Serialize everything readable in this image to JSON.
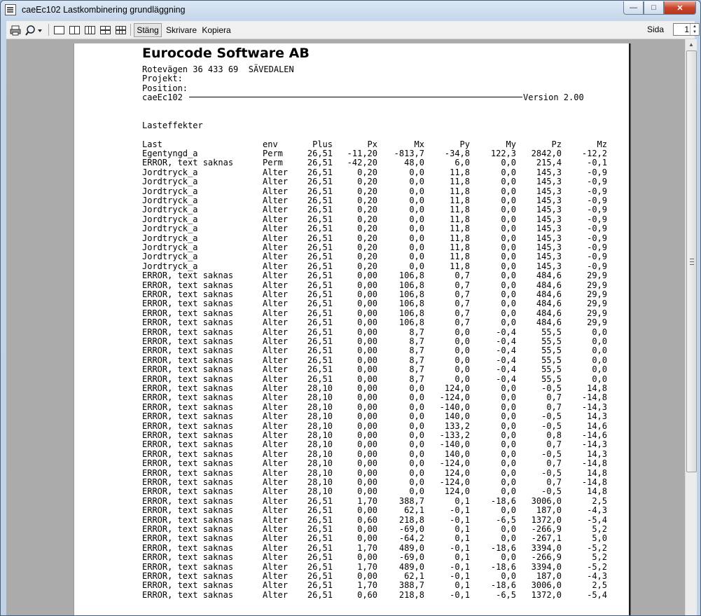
{
  "window": {
    "title": "caeEc102 Lastkombinering grundläggning"
  },
  "toolbar": {
    "icons": [
      "printer-icon",
      "zoom-icon",
      "one-page-icon",
      "two-page-icon",
      "three-page-icon",
      "four-page-icon",
      "six-page-icon"
    ],
    "close_label": "Stäng",
    "printer_label": "Skrivare",
    "copy_label": "Kopiera",
    "page_label": "Sida",
    "page_value": "1"
  },
  "report": {
    "company": "Eurocode Software AB",
    "address": "Rotevägen 36 433 69  SÄVEDALEN",
    "project": "Projekt:",
    "position": "Position:",
    "program": "caeEc102",
    "version": "Version 2.00",
    "section": "Lasteffekter",
    "columns": [
      "Last",
      "env",
      "Plus",
      "Px",
      "Mx",
      "Py",
      "My",
      "Pz",
      "Mz"
    ],
    "rows": [
      [
        "Egentyngd_a",
        "Perm",
        "26,51",
        "-11,20",
        "-813,7",
        "-34,8",
        "122,3",
        "2842,0",
        "-12,2"
      ],
      [
        "ERROR, text saknas",
        "Perm",
        "26,51",
        "-42,20",
        "48,0",
        "6,0",
        "0,0",
        "215,4",
        "-0,1"
      ],
      [
        "Jordtryck_a",
        "Alter",
        "26,51",
        "0,20",
        "0,0",
        "11,8",
        "0,0",
        "145,3",
        "-0,9"
      ],
      [
        "Jordtryck_a",
        "Alter",
        "26,51",
        "0,20",
        "0,0",
        "11,8",
        "0,0",
        "145,3",
        "-0,9"
      ],
      [
        "Jordtryck_a",
        "Alter",
        "26,51",
        "0,20",
        "0,0",
        "11,8",
        "0,0",
        "145,3",
        "-0,9"
      ],
      [
        "Jordtryck_a",
        "Alter",
        "26,51",
        "0,20",
        "0,0",
        "11,8",
        "0,0",
        "145,3",
        "-0,9"
      ],
      [
        "Jordtryck_a",
        "Alter",
        "26,51",
        "0,20",
        "0,0",
        "11,8",
        "0,0",
        "145,3",
        "-0,9"
      ],
      [
        "Jordtryck_a",
        "Alter",
        "26,51",
        "0,20",
        "0,0",
        "11,8",
        "0,0",
        "145,3",
        "-0,9"
      ],
      [
        "Jordtryck_a",
        "Alter",
        "26,51",
        "0,20",
        "0,0",
        "11,8",
        "0,0",
        "145,3",
        "-0,9"
      ],
      [
        "Jordtryck_a",
        "Alter",
        "26,51",
        "0,20",
        "0,0",
        "11,8",
        "0,0",
        "145,3",
        "-0,9"
      ],
      [
        "Jordtryck_a",
        "Alter",
        "26,51",
        "0,20",
        "0,0",
        "11,8",
        "0,0",
        "145,3",
        "-0,9"
      ],
      [
        "Jordtryck_a",
        "Alter",
        "26,51",
        "0,20",
        "0,0",
        "11,8",
        "0,0",
        "145,3",
        "-0,9"
      ],
      [
        "Jordtryck_a",
        "Alter",
        "26,51",
        "0,20",
        "0,0",
        "11,8",
        "0,0",
        "145,3",
        "-0,9"
      ],
      [
        "ERROR, text saknas",
        "Alter",
        "26,51",
        "0,00",
        "106,8",
        "0,7",
        "0,0",
        "484,6",
        "29,9"
      ],
      [
        "ERROR, text saknas",
        "Alter",
        "26,51",
        "0,00",
        "106,8",
        "0,7",
        "0,0",
        "484,6",
        "29,9"
      ],
      [
        "ERROR, text saknas",
        "Alter",
        "26,51",
        "0,00",
        "106,8",
        "0,7",
        "0,0",
        "484,6",
        "29,9"
      ],
      [
        "ERROR, text saknas",
        "Alter",
        "26,51",
        "0,00",
        "106,8",
        "0,7",
        "0,0",
        "484,6",
        "29,9"
      ],
      [
        "ERROR, text saknas",
        "Alter",
        "26,51",
        "0,00",
        "106,8",
        "0,7",
        "0,0",
        "484,6",
        "29,9"
      ],
      [
        "ERROR, text saknas",
        "Alter",
        "26,51",
        "0,00",
        "106,8",
        "0,7",
        "0,0",
        "484,6",
        "29,9"
      ],
      [
        "ERROR, text saknas",
        "Alter",
        "26,51",
        "0,00",
        "8,7",
        "0,0",
        "-0,4",
        "55,5",
        "0,0"
      ],
      [
        "ERROR, text saknas",
        "Alter",
        "26,51",
        "0,00",
        "8,7",
        "0,0",
        "-0,4",
        "55,5",
        "0,0"
      ],
      [
        "ERROR, text saknas",
        "Alter",
        "26,51",
        "0,00",
        "8,7",
        "0,0",
        "-0,4",
        "55,5",
        "0,0"
      ],
      [
        "ERROR, text saknas",
        "Alter",
        "26,51",
        "0,00",
        "8,7",
        "0,0",
        "-0,4",
        "55,5",
        "0,0"
      ],
      [
        "ERROR, text saknas",
        "Alter",
        "26,51",
        "0,00",
        "8,7",
        "0,0",
        "-0,4",
        "55,5",
        "0,0"
      ],
      [
        "ERROR, text saknas",
        "Alter",
        "26,51",
        "0,00",
        "8,7",
        "0,0",
        "-0,4",
        "55,5",
        "0,0"
      ],
      [
        "ERROR, text saknas",
        "Alter",
        "28,10",
        "0,00",
        "0,0",
        "124,0",
        "0,0",
        "-0,5",
        "14,8"
      ],
      [
        "ERROR, text saknas",
        "Alter",
        "28,10",
        "0,00",
        "0,0",
        "-124,0",
        "0,0",
        "0,7",
        "-14,8"
      ],
      [
        "ERROR, text saknas",
        "Alter",
        "28,10",
        "0,00",
        "0,0",
        "-140,0",
        "0,0",
        "0,7",
        "-14,3"
      ],
      [
        "ERROR, text saknas",
        "Alter",
        "28,10",
        "0,00",
        "0,0",
        "140,0",
        "0,0",
        "-0,5",
        "14,3"
      ],
      [
        "ERROR, text saknas",
        "Alter",
        "28,10",
        "0,00",
        "0,0",
        "133,2",
        "0,0",
        "-0,5",
        "14,6"
      ],
      [
        "ERROR, text saknas",
        "Alter",
        "28,10",
        "0,00",
        "0,0",
        "-133,2",
        "0,0",
        "0,8",
        "-14,6"
      ],
      [
        "ERROR, text saknas",
        "Alter",
        "28,10",
        "0,00",
        "0,0",
        "-140,0",
        "0,0",
        "0,7",
        "-14,3"
      ],
      [
        "ERROR, text saknas",
        "Alter",
        "28,10",
        "0,00",
        "0,0",
        "140,0",
        "0,0",
        "-0,5",
        "14,3"
      ],
      [
        "ERROR, text saknas",
        "Alter",
        "28,10",
        "0,00",
        "0,0",
        "-124,0",
        "0,0",
        "0,7",
        "-14,8"
      ],
      [
        "ERROR, text saknas",
        "Alter",
        "28,10",
        "0,00",
        "0,0",
        "124,0",
        "0,0",
        "-0,5",
        "14,8"
      ],
      [
        "ERROR, text saknas",
        "Alter",
        "28,10",
        "0,00",
        "0,0",
        "-124,0",
        "0,0",
        "0,7",
        "-14,8"
      ],
      [
        "ERROR, text saknas",
        "Alter",
        "28,10",
        "0,00",
        "0,0",
        "124,0",
        "0,0",
        "-0,5",
        "14,8"
      ],
      [
        "ERROR, text saknas",
        "Alter",
        "26,51",
        "1,70",
        "388,7",
        "0,1",
        "-18,6",
        "3006,0",
        "2,5"
      ],
      [
        "ERROR, text saknas",
        "Alter",
        "26,51",
        "0,00",
        "62,1",
        "-0,1",
        "0,0",
        "187,0",
        "-4,3"
      ],
      [
        "ERROR, text saknas",
        "Alter",
        "26,51",
        "0,60",
        "218,8",
        "-0,1",
        "-6,5",
        "1372,0",
        "-5,4"
      ],
      [
        "ERROR, text saknas",
        "Alter",
        "26,51",
        "0,00",
        "-69,0",
        "0,1",
        "0,0",
        "-266,9",
        "5,2"
      ],
      [
        "ERROR, text saknas",
        "Alter",
        "26,51",
        "0,00",
        "-64,2",
        "0,1",
        "0,0",
        "-267,1",
        "5,0"
      ],
      [
        "ERROR, text saknas",
        "Alter",
        "26,51",
        "1,70",
        "489,0",
        "-0,1",
        "-18,6",
        "3394,0",
        "-5,2"
      ],
      [
        "ERROR, text saknas",
        "Alter",
        "26,51",
        "0,00",
        "-69,0",
        "0,1",
        "0,0",
        "-266,9",
        "5,2"
      ],
      [
        "ERROR, text saknas",
        "Alter",
        "26,51",
        "1,70",
        "489,0",
        "-0,1",
        "-18,6",
        "3394,0",
        "-5,2"
      ],
      [
        "ERROR, text saknas",
        "Alter",
        "26,51",
        "0,00",
        "62,1",
        "-0,1",
        "0,0",
        "187,0",
        "-4,3"
      ],
      [
        "ERROR, text saknas",
        "Alter",
        "26,51",
        "1,70",
        "388,7",
        "0,1",
        "-18,6",
        "3006,0",
        "2,5"
      ],
      [
        "ERROR, text saknas",
        "Alter",
        "26,51",
        "0,60",
        "218,8",
        "-0,1",
        "-6,5",
        "1372,0",
        "-5,4"
      ]
    ]
  }
}
